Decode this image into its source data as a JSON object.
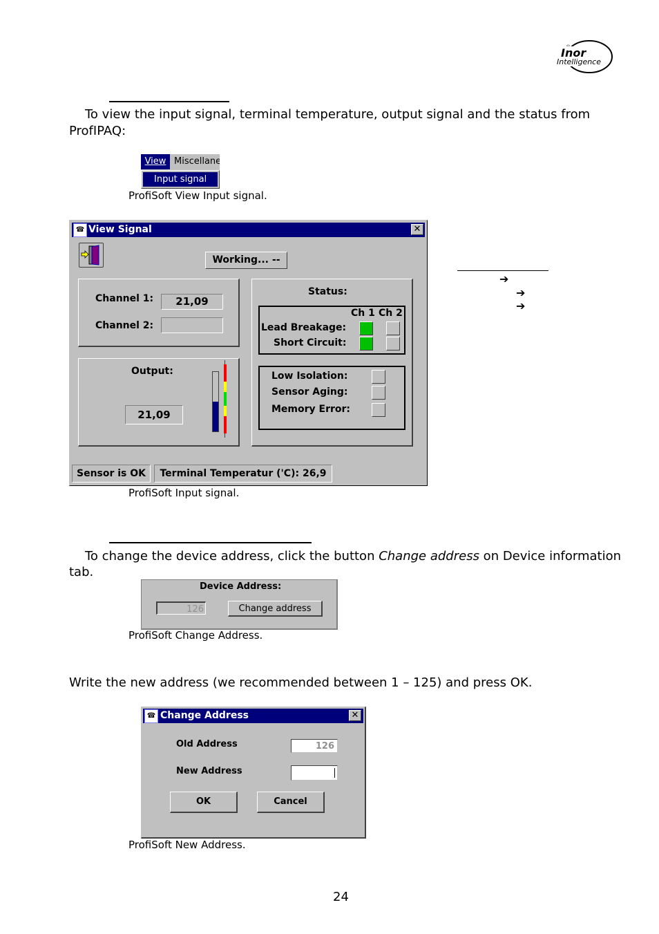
{
  "logo": {
    "brand": "Inor",
    "tagline": "Intelligence",
    "registered": "®"
  },
  "section1": {
    "paragraph_line1": "To view the input signal, terminal temperature, output signal and the status from",
    "paragraph_line2": "ProfIPAQ:",
    "menu": {
      "view": "View",
      "miscellaneous": "Miscellaneo",
      "input_signal": "Input signal"
    },
    "menu_caption": "ProfiSoft View Input signal."
  },
  "view_signal": {
    "title": "View Signal",
    "close": "✕",
    "working": "Working... --",
    "channel1_label": "Channel 1:",
    "channel1_value": "21,09",
    "channel2_label": "Channel 2:",
    "channel2_value": "",
    "output_label": "Output:",
    "output_value": "21,09",
    "output_bar_fraction": 0.5,
    "scale_colors": [
      "#ff0000",
      "#ffff00",
      "#00e000",
      "#ffff00",
      "#ff0000"
    ],
    "status_label": "Status:",
    "ch1_header": "Ch 1",
    "ch2_header": "Ch 2",
    "lead_breakage_label": "Lead Breakage:",
    "short_circuit_label": "Short Circuit:",
    "lead_breakage": {
      "ch1": true,
      "ch2": false
    },
    "short_circuit": {
      "ch1": true,
      "ch2": false
    },
    "low_isolation_label": "Low Isolation:",
    "sensor_aging_label": "Sensor Aging:",
    "memory_error_label": "Memory Error:",
    "sensor_status": "Sensor is OK",
    "terminal_temp": "Terminal Temperatur ('C): 26,9",
    "caption": "ProfiSoft Input signal."
  },
  "side_arrows": [
    "➔",
    "➔",
    "➔"
  ],
  "section2": {
    "paragraph_pre": "To change the device address, click the button ",
    "paragraph_italic": "Change address",
    "paragraph_post": " on Device information",
    "paragraph_line2": "tab.",
    "device_address_label": "Device Address:",
    "device_address_value": "126",
    "change_address_button": "Change address",
    "caption": "ProfiSoft Change Address."
  },
  "section3": {
    "paragraph": "Write the new address (we recommended between 1 – 125) and press OK.",
    "dialog_title": "Change Address",
    "close": "✕",
    "old_address_label": "Old Address",
    "old_address_value": "126",
    "new_address_label": "New Address",
    "new_address_value": "",
    "ok_button": "OK",
    "cancel_button": "Cancel",
    "caption": "ProfiSoft New Address."
  },
  "page_number": "24"
}
